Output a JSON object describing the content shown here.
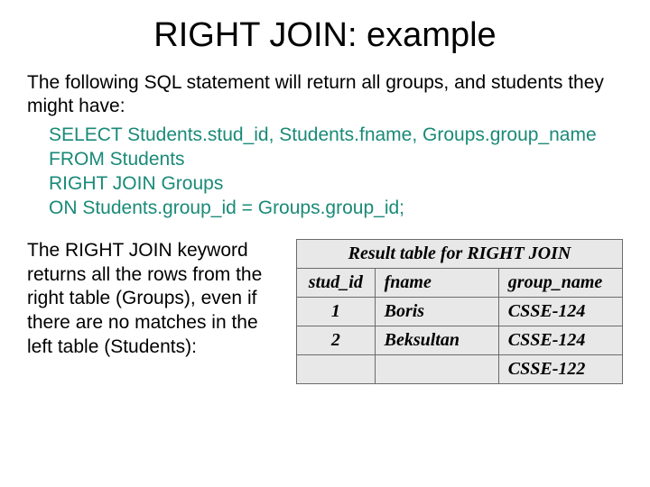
{
  "title": "RIGHT JOIN: example",
  "intro": "The following SQL statement will return all groups, and students they might have:",
  "sql": {
    "l1": "SELECT Students.stud_id, Students.fname, Groups.group_name",
    "l2": "FROM Students",
    "l3": "RIGHT JOIN Groups",
    "l4": "ON Students.group_id = Groups.group_id;"
  },
  "explain": "The RIGHT JOIN keyword returns all the rows from the right table (Groups), even if there are no matches in the left table (Students):",
  "table": {
    "caption": "Result table for RIGHT JOIN",
    "headers": {
      "c1": "stud_id",
      "c2": "fname",
      "c3": "group_name"
    },
    "rows": [
      {
        "c1": "1",
        "c2": "Boris",
        "c3": "CSSE-124"
      },
      {
        "c1": "2",
        "c2": "Beksultan",
        "c3": "CSSE-124"
      },
      {
        "c1": "",
        "c2": "",
        "c3": "CSSE-122"
      }
    ]
  },
  "chart_data": {
    "type": "table",
    "title": "Result table for RIGHT JOIN",
    "columns": [
      "stud_id",
      "fname",
      "group_name"
    ],
    "rows": [
      [
        1,
        "Boris",
        "CSSE-124"
      ],
      [
        2,
        "Beksultan",
        "CSSE-124"
      ],
      [
        null,
        null,
        "CSSE-122"
      ]
    ]
  }
}
